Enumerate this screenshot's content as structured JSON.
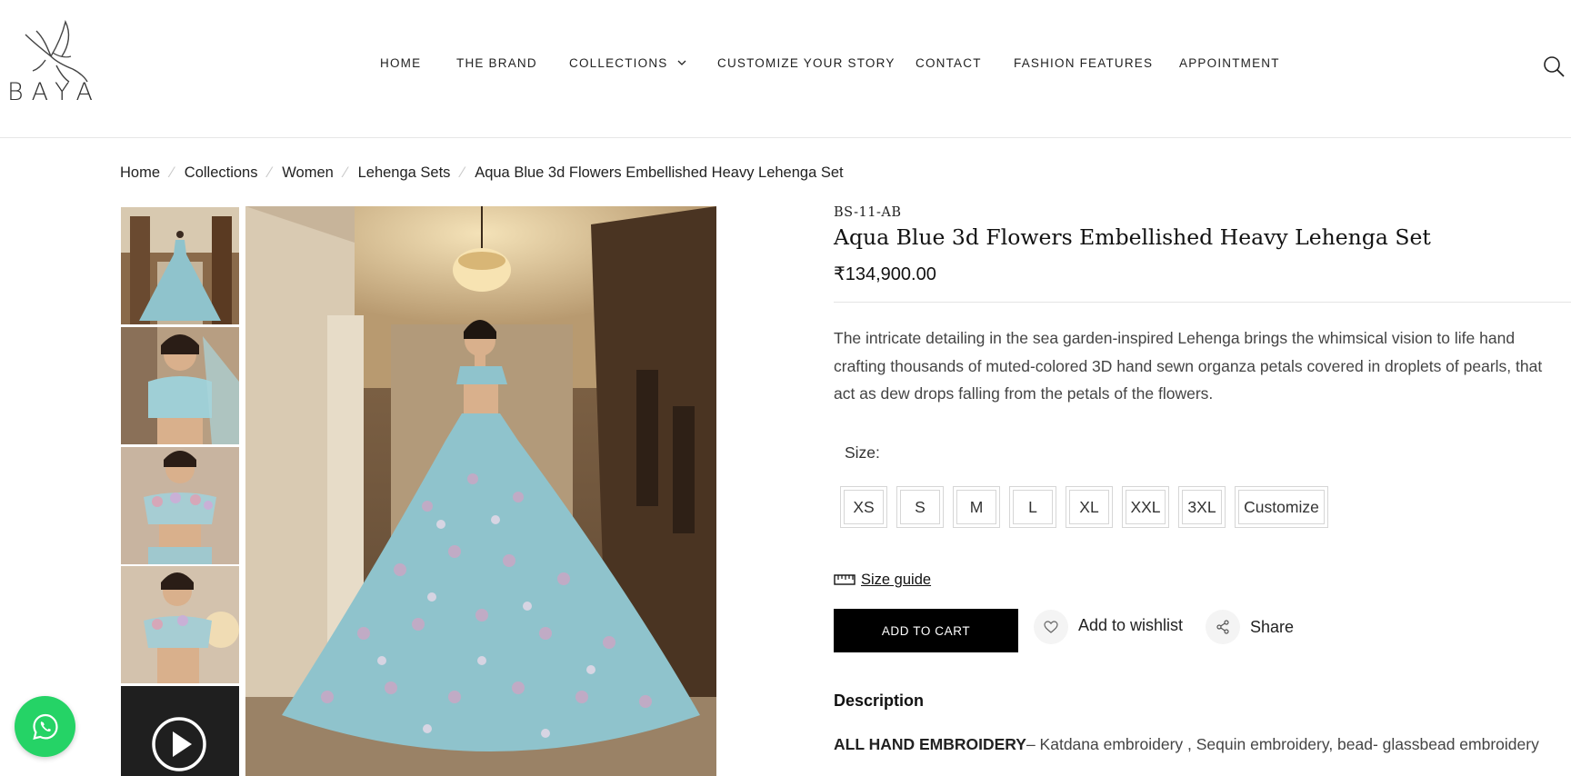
{
  "brand": {
    "logo_text": "BAYA"
  },
  "nav": {
    "items": [
      {
        "label": "HOME"
      },
      {
        "label": "THE BRAND"
      },
      {
        "label": "COLLECTIONS"
      },
      {
        "label": "CUSTOMIZE YOUR STORY"
      },
      {
        "label": "CONTACT"
      },
      {
        "label": "FASHION FEATURES"
      },
      {
        "label": "APPOINTMENT"
      }
    ],
    "search_icon": "search-icon"
  },
  "breadcrumb": [
    "Home",
    "Collections",
    "Women",
    "Lehenga Sets",
    "Aqua Blue 3d Flowers Embellished Heavy Lehenga Set"
  ],
  "product": {
    "sku": "BS-11-AB",
    "title": "Aqua Blue 3d Flowers Embellished Heavy Lehenga Set",
    "price": "₹134,900.00",
    "description": "The intricate detailing in the sea garden-inspired Lehenga brings the whimsical vision to life hand crafting thousands of muted-colored 3D hand sewn organza petals covered in droplets of pearls, that act as dew drops falling from the petals of the flowers.",
    "size_label": "Size:",
    "sizes": [
      "XS",
      "S",
      "M",
      "L",
      "XL",
      "XXL",
      "3XL",
      "Customize"
    ],
    "size_guide": "Size guide",
    "add_to_cart": "ADD TO CART",
    "wishlist": "Add to wishlist",
    "share": "Share",
    "description_heading": "Description",
    "embroidery_label": "ALL HAND EMBROIDERY",
    "embroidery_text": "– Katdana embroidery , Sequin embroidery, bead- glassbead embroidery"
  },
  "colors": {
    "accent": "#000000",
    "whatsapp": "#25d366",
    "lehenga": "#8fc3cc"
  }
}
